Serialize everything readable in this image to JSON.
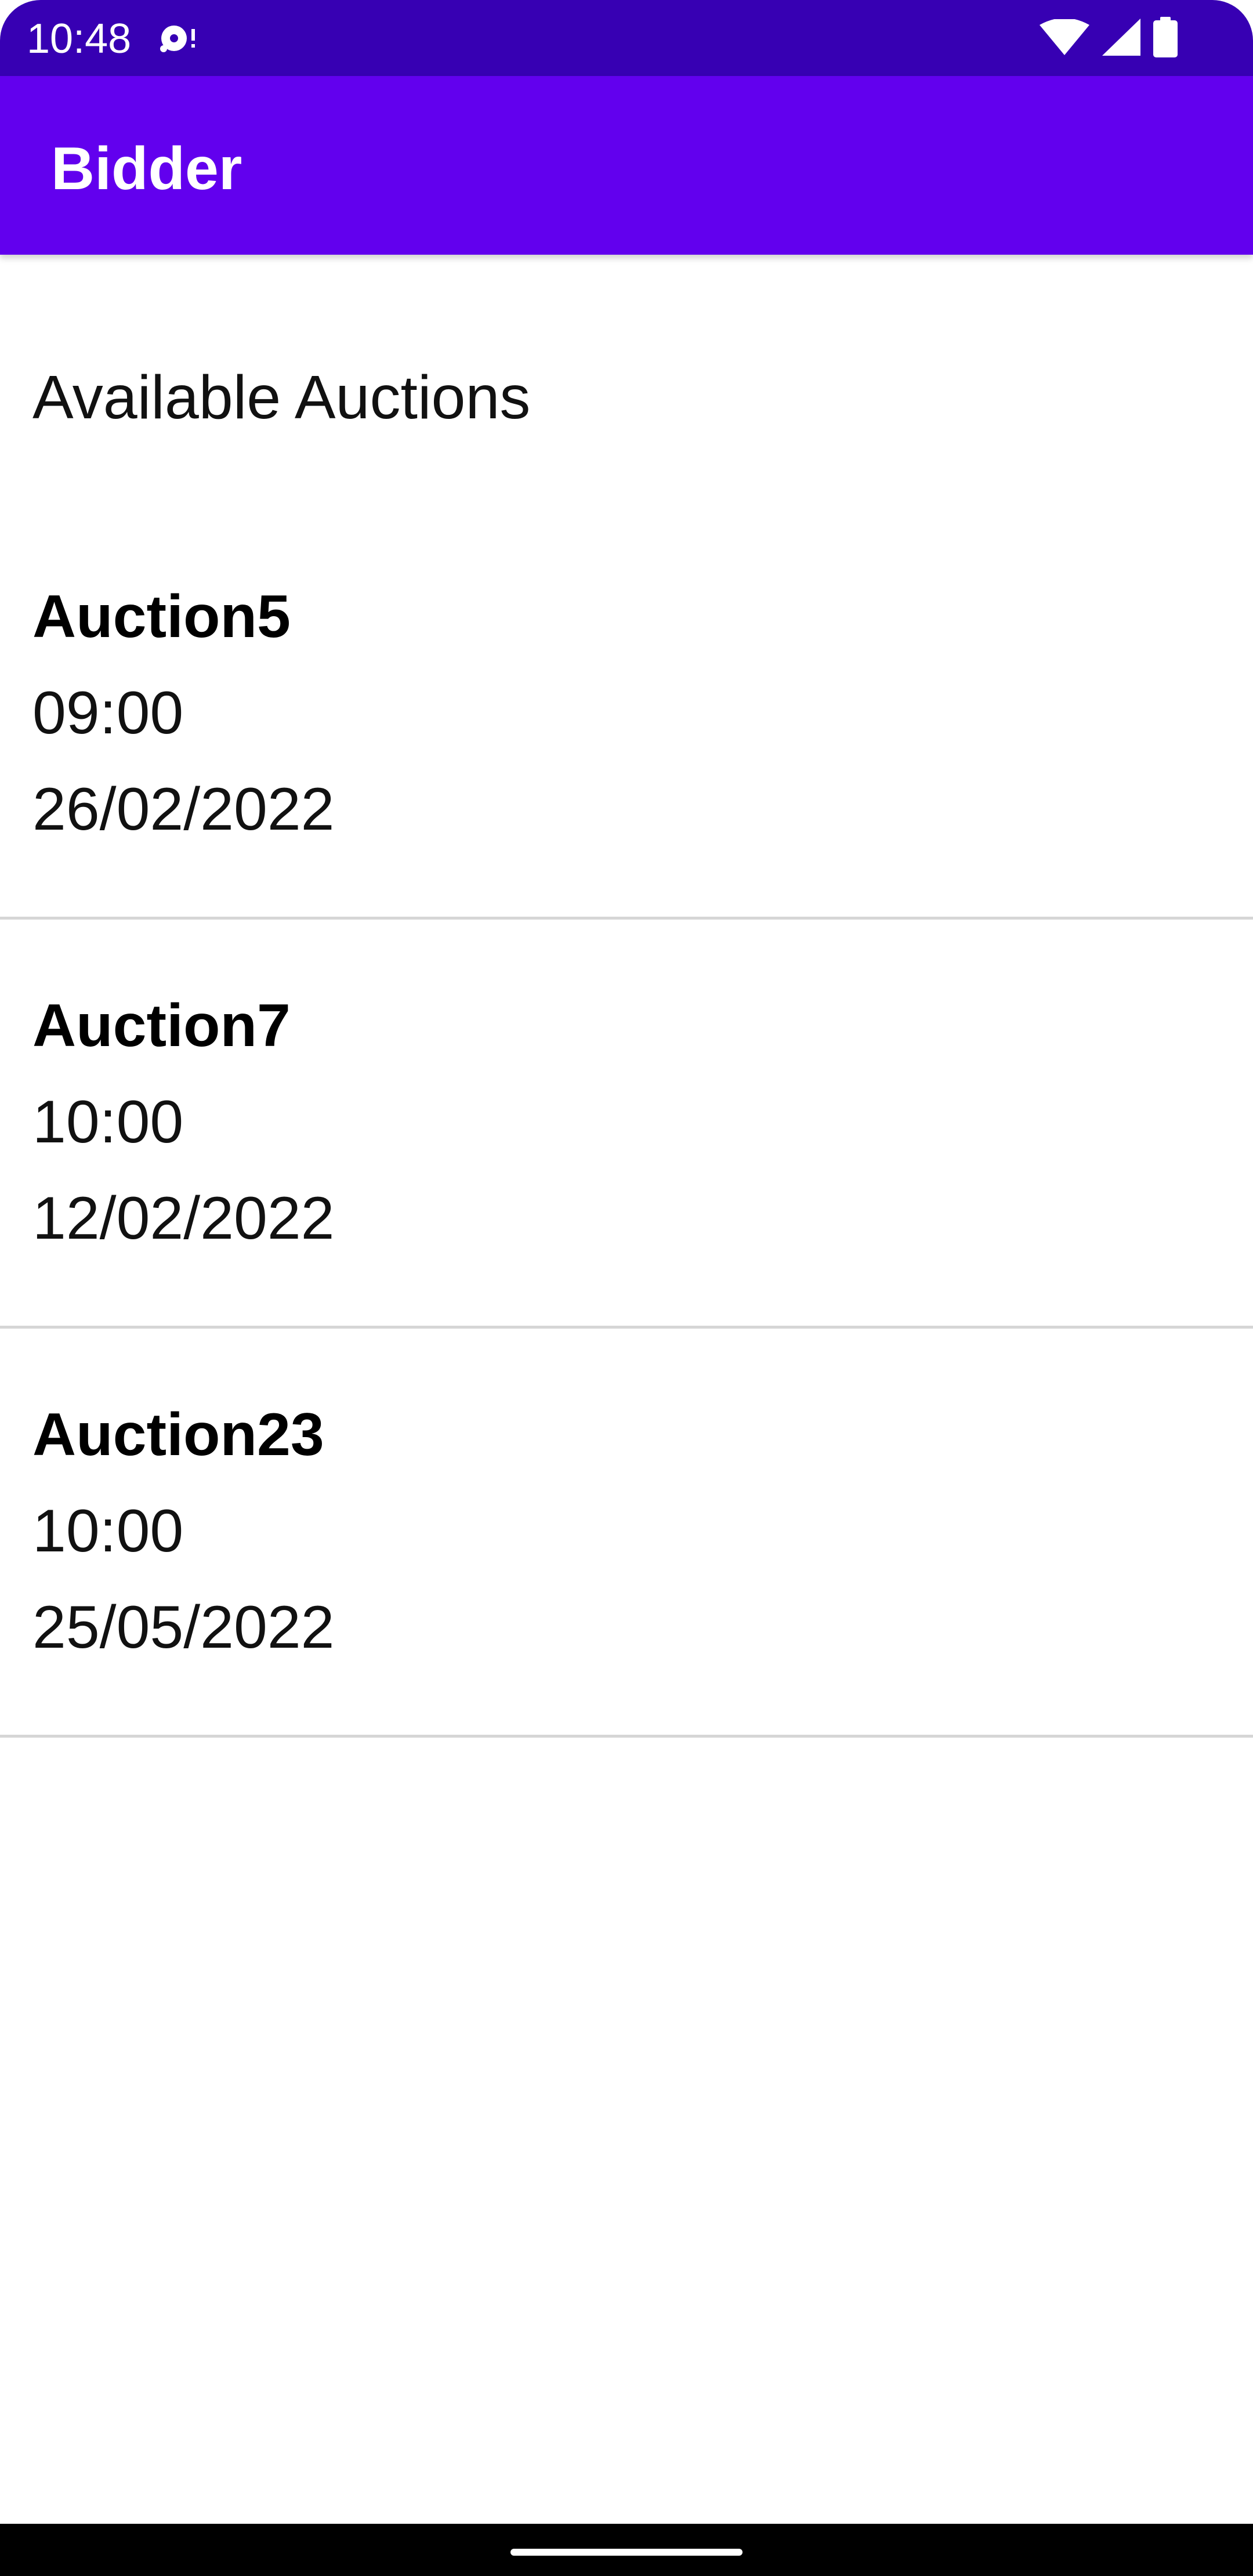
{
  "status_bar": {
    "time": "10:48",
    "notification_icon": "media-notification-icon",
    "icons": [
      "wifi-icon",
      "cell-signal-icon",
      "battery-icon"
    ],
    "background_color": "#3700b3"
  },
  "app_bar": {
    "title": "Bidder",
    "background_color": "#6200ee"
  },
  "main": {
    "heading": "Available Auctions",
    "auctions": [
      {
        "name": "Auction5",
        "time": "09:00",
        "date": "26/02/2022"
      },
      {
        "name": "Auction7",
        "time": "10:00",
        "date": "12/02/2022"
      },
      {
        "name": "Auction23",
        "time": "10:00",
        "date": "25/05/2022"
      }
    ]
  },
  "nav_bar": {
    "handle": "home-gesture-handle"
  }
}
